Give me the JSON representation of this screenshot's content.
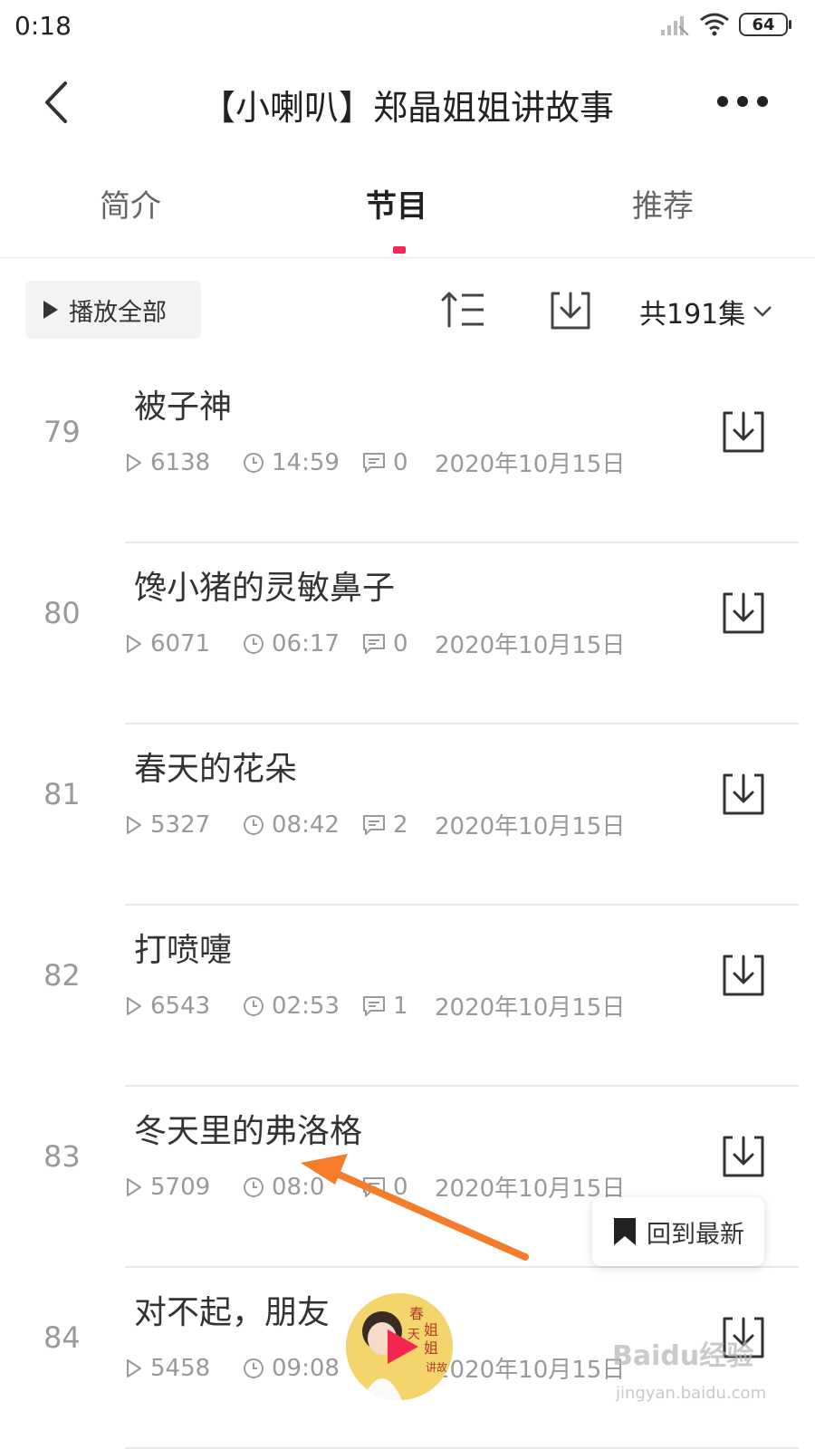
{
  "status": {
    "time": "0:18",
    "battery": "64"
  },
  "header": {
    "title": "【小喇叭】郑晶姐姐讲故事"
  },
  "tabs": [
    {
      "label": "简介",
      "active": false
    },
    {
      "label": "节目",
      "active": true
    },
    {
      "label": "推荐",
      "active": false
    }
  ],
  "toolbar": {
    "play_all": "播放全部",
    "episode_count": "共191集"
  },
  "episodes": [
    {
      "num": "79",
      "title": "被子神",
      "plays": "6138",
      "duration": "14:59",
      "comments": "0",
      "date": "2020年10月15日"
    },
    {
      "num": "80",
      "title": "馋小猪的灵敏鼻子",
      "plays": "6071",
      "duration": "06:17",
      "comments": "0",
      "date": "2020年10月15日"
    },
    {
      "num": "81",
      "title": "春天的花朵",
      "plays": "5327",
      "duration": "08:42",
      "comments": "2",
      "date": "2020年10月15日"
    },
    {
      "num": "82",
      "title": "打喷嚏",
      "plays": "6543",
      "duration": "02:53",
      "comments": "1",
      "date": "2020年10月15日"
    },
    {
      "num": "83",
      "title": "冬天里的弗洛格",
      "plays": "5709",
      "duration": "08:0",
      "comments": "0",
      "date": "2020年10月15日"
    },
    {
      "num": "84",
      "title": "对不起，朋友",
      "plays": "5458",
      "duration": "09:08",
      "comments": "",
      "date": "2020年10月15日"
    }
  ],
  "floating": {
    "back_to_latest": "回到最新"
  },
  "player": {
    "cover_text": "春天姐姐讲故事"
  },
  "watermark": {
    "brand": "Baidu经验",
    "url": "jingyan.baidu.com"
  },
  "colors": {
    "accent": "#f5264f",
    "annotation_arrow": "#f47c2a"
  }
}
